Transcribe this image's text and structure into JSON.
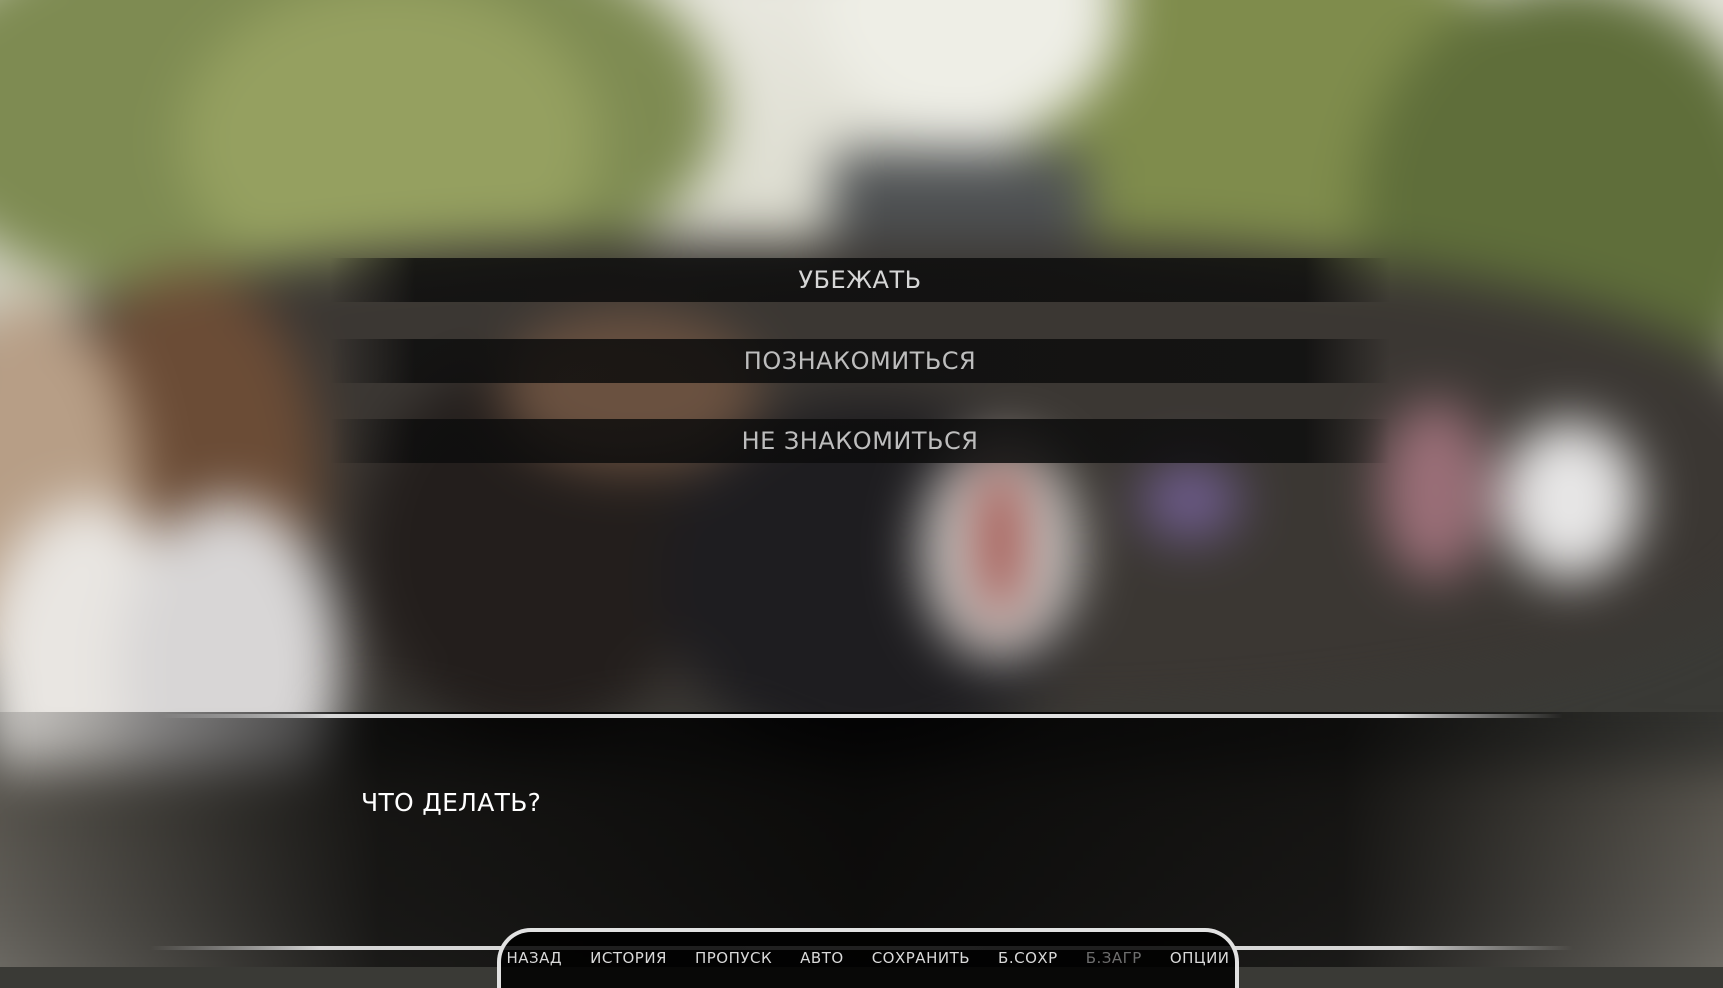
{
  "choices": [
    {
      "label": "УБЕЖАТЬ"
    },
    {
      "label": "ПОЗНАКОМИТЬСЯ"
    },
    {
      "label": "НЕ ЗНАКОМИТЬСЯ"
    }
  ],
  "dialogue": {
    "text": "ЧТО ДЕЛАТЬ?"
  },
  "quick_menu": {
    "items": [
      {
        "label": "НАЗАД",
        "enabled": true
      },
      {
        "label": "ИСТОРИЯ",
        "enabled": true
      },
      {
        "label": "ПРОПУСК",
        "enabled": true
      },
      {
        "label": "АВТО",
        "enabled": true
      },
      {
        "label": "СОХРАНИТЬ",
        "enabled": true
      },
      {
        "label": "Б.СОХР",
        "enabled": true
      },
      {
        "label": "Б.ЗАГР",
        "enabled": false
      },
      {
        "label": "ОПЦИИ",
        "enabled": true
      }
    ]
  },
  "colors": {
    "choice_text": "#d6d6d6",
    "dialogue_text": "#ffffff",
    "frame_line": "#e2e2e2",
    "disabled_text": "#6e6e6e"
  }
}
